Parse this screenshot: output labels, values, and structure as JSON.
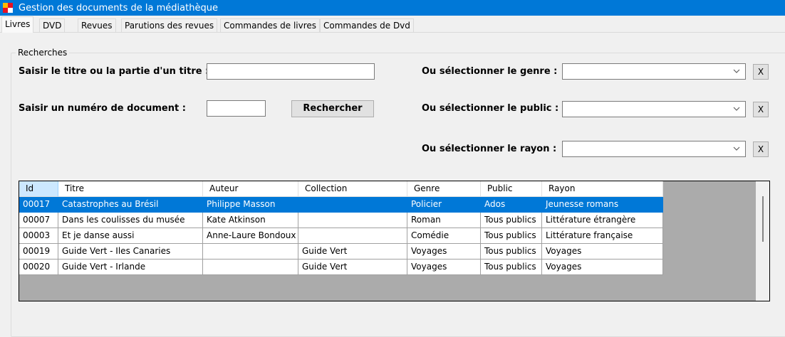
{
  "window": {
    "title": "Gestion des documents de la médiathèque"
  },
  "tabs": [
    {
      "label": "Livres",
      "active": true
    },
    {
      "label": "DVD"
    },
    {
      "label": "Revues"
    },
    {
      "label": "Parutions des revues"
    },
    {
      "label": "Commandes de livres"
    },
    {
      "label": "Commandes de Dvd"
    }
  ],
  "search": {
    "group_label": "Recherches",
    "title_label": "Saisir le titre ou la partie d'un titre :",
    "title_value": "",
    "number_label": "Saisir un numéro de document :",
    "number_value": "",
    "search_button": "Rechercher",
    "genre_label": "Ou sélectionner le genre :",
    "genre_value": "",
    "public_label": "Ou sélectionner le public :",
    "public_value": "",
    "rayon_label": "Ou sélectionner le rayon :",
    "rayon_value": "",
    "clear_label": "X"
  },
  "table": {
    "columns": [
      "Id",
      "Titre",
      "Auteur",
      "Collection",
      "Genre",
      "Public",
      "Rayon"
    ],
    "rows": [
      [
        "00017",
        "Catastrophes au Brésil",
        "Philippe Masson",
        "",
        "Policier",
        "Ados",
        "Jeunesse romans"
      ],
      [
        "00007",
        "Dans les coulisses du musée",
        "Kate Atkinson",
        "",
        "Roman",
        "Tous publics",
        "Littérature étrangère"
      ],
      [
        "00003",
        "Et je danse aussi",
        "Anne-Laure Bondoux",
        "",
        "Comédie",
        "Tous publics",
        "Littérature française"
      ],
      [
        "00019",
        "Guide Vert - Iles Canaries",
        "",
        "Guide Vert",
        "Voyages",
        "Tous publics",
        "Voyages"
      ],
      [
        "00020",
        "Guide Vert - Irlande",
        "",
        "Guide Vert",
        "Voyages",
        "Tous publics",
        "Voyages"
      ]
    ],
    "selected_row": 0
  },
  "colors": {
    "titlebar": "#0078d7",
    "selection": "#0078d7",
    "header_selected": "#cce8ff"
  }
}
